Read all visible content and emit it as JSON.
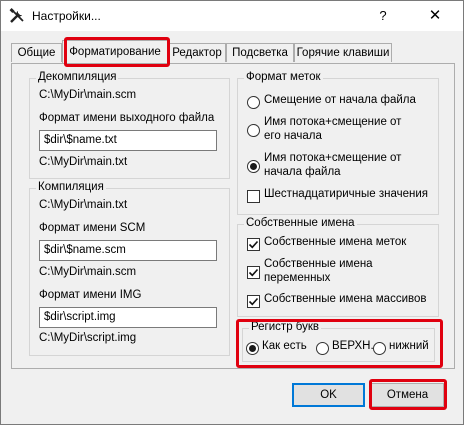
{
  "window": {
    "title": "Настройки...",
    "help_label": "?",
    "close_label": "✕"
  },
  "tabs": [
    {
      "label": "Общие"
    },
    {
      "label": "Форматирование"
    },
    {
      "label": "Редактор"
    },
    {
      "label": "Подсветка"
    },
    {
      "label": "Горячие клавиши"
    }
  ],
  "decompile": {
    "title": "Декомпиляция",
    "path": "C:\\MyDir\\main.scm",
    "output_format_label": "Формат имени выходного файла",
    "output_format_value": "$dir\\$name.txt",
    "output_preview": "C:\\MyDir\\main.txt"
  },
  "compile": {
    "title": "Компиляция",
    "path": "C:\\MyDir\\main.txt",
    "scm_format_label": "Формат имени SCM",
    "scm_format_value": "$dir\\$name.scm",
    "scm_preview": "C:\\MyDir\\main.scm",
    "img_format_label": "Формат имени IMG",
    "img_format_value": "$dir\\script.img",
    "img_preview": "C:\\MyDir\\script.img"
  },
  "label_format": {
    "title": "Формат меток",
    "options": [
      {
        "label": "Смещение от начала файла",
        "selected": false
      },
      {
        "label": "Имя потока+смещение от его начала",
        "line1": "Имя потока+смещение от",
        "line2": "его начала",
        "selected": false
      },
      {
        "label": "Имя потока+смещение от начала файла",
        "line1": "Имя потока+смещение от",
        "line2": "начала файла",
        "selected": true
      }
    ],
    "hex_label": "Шестнадцатиричные значения",
    "hex_checked": false
  },
  "own_names": {
    "title": "Собственные имена",
    "items": [
      {
        "label": "Собственные имена меток",
        "checked": true
      },
      {
        "label": "Собственные имена переменных",
        "line1": "Собственные имена",
        "line2": "переменных",
        "checked": true
      },
      {
        "label": "Собственные имена массивов",
        "checked": true
      }
    ]
  },
  "letter_case": {
    "title": "Регистр букв",
    "options": [
      {
        "label": "Как есть",
        "selected": true
      },
      {
        "label": "ВЕРХН.",
        "selected": false
      },
      {
        "label": "нижний",
        "selected": false
      }
    ]
  },
  "buttons": {
    "ok": "OK",
    "cancel": "Отмена"
  },
  "colors": {
    "highlight": "#e0000f",
    "accent": "#0078d7"
  }
}
